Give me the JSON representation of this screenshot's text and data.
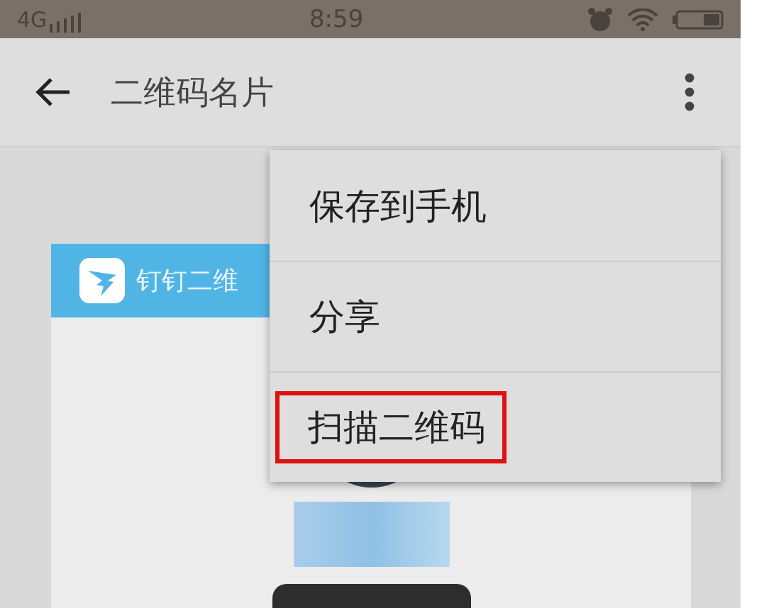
{
  "status_bar": {
    "network": "4G",
    "time": "8:59"
  },
  "app_bar": {
    "title": "二维码名片"
  },
  "card": {
    "header": "钉钉二维"
  },
  "menu": {
    "items": [
      {
        "label": "保存到手机",
        "highlighted": false
      },
      {
        "label": "分享",
        "highlighted": false
      },
      {
        "label": "扫描二维码",
        "highlighted": true
      }
    ]
  }
}
